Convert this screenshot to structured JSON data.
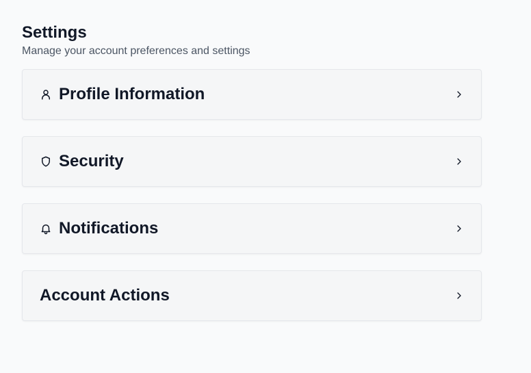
{
  "header": {
    "title": "Settings",
    "subtitle": "Manage your account preferences and settings"
  },
  "sections": [
    {
      "label": "Profile Information",
      "icon": "user-icon"
    },
    {
      "label": "Security",
      "icon": "shield-icon"
    },
    {
      "label": "Notifications",
      "icon": "bell-icon"
    },
    {
      "label": "Account Actions",
      "icon": ""
    }
  ],
  "colors": {
    "background": "#f9fafb",
    "card_background": "#f5f6f7",
    "card_border": "#e5e7eb",
    "text": "#111827",
    "muted_text": "#4b5563"
  }
}
